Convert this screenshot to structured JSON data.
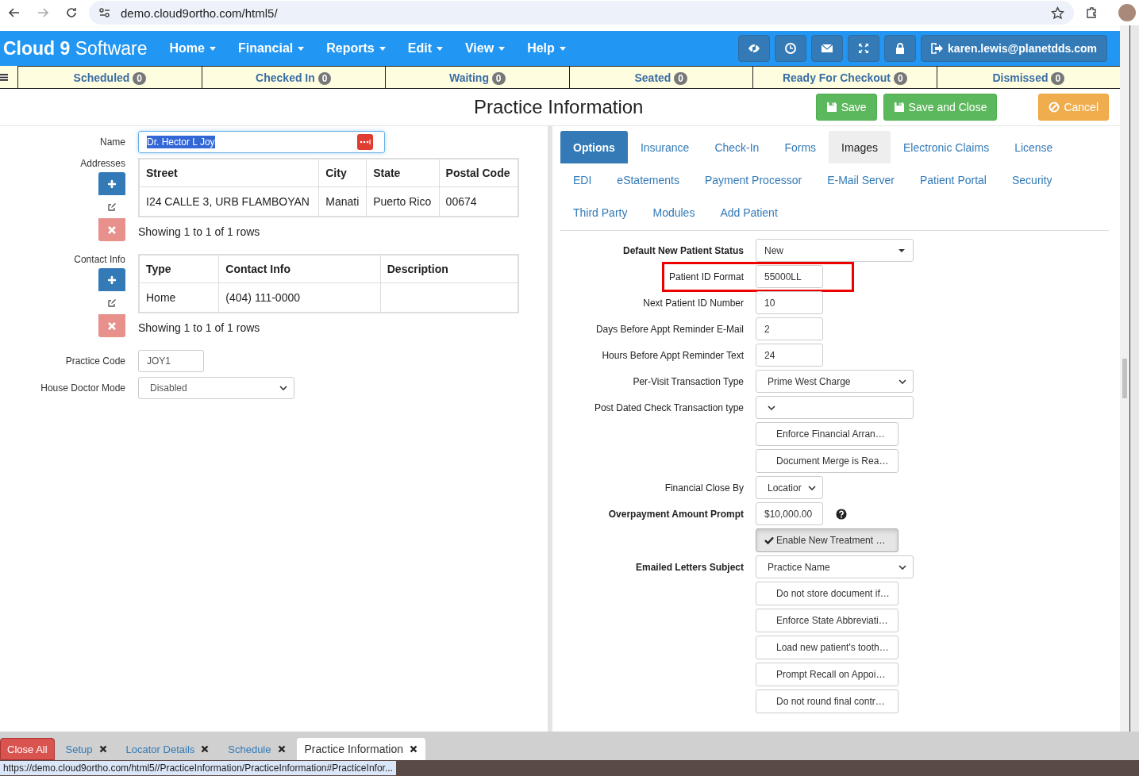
{
  "browser": {
    "url": "demo.cloud9ortho.com/html5/"
  },
  "navbar": {
    "brand_bold": "Cloud 9",
    "brand_light": "Software",
    "menus": [
      "Home",
      "Financial",
      "Reports",
      "Edit",
      "View",
      "Help"
    ],
    "user": "karen.lewis@planetdds.com"
  },
  "status_tabs": [
    {
      "label": "Scheduled",
      "count": "0"
    },
    {
      "label": "Checked In",
      "count": "0"
    },
    {
      "label": "Waiting",
      "count": "0"
    },
    {
      "label": "Seated",
      "count": "0"
    },
    {
      "label": "Ready For Checkout",
      "count": "0"
    },
    {
      "label": "Dismissed",
      "count": "0"
    }
  ],
  "page": {
    "title": "Practice Information",
    "buttons": [
      {
        "label": "Save",
        "kind": "save"
      },
      {
        "label": "Save and Close",
        "kind": "save"
      },
      {
        "label": "Cancel",
        "kind": "cancel"
      }
    ]
  },
  "practice": {
    "name_label": "Name",
    "name": "Dr. Hector L Joy",
    "name_selected": true,
    "addresses_label": "Addresses",
    "addresses": {
      "columns": [
        "Street",
        "City",
        "State",
        "Postal Code"
      ],
      "rows": [
        [
          "I24 CALLE 3, URB FLAMBOYAN",
          "Manati",
          "Puerto Rico",
          "00674"
        ]
      ],
      "footer": "Showing 1 to 1 of 1 rows"
    },
    "contact_label": "Contact Info",
    "contacts": {
      "columns": [
        "Type",
        "Contact Info",
        "Description"
      ],
      "rows": [
        [
          "Home",
          "(404) 111-0000",
          ""
        ]
      ],
      "footer": "Showing 1 to 1 of 1 rows"
    },
    "code_label": "Practice Code",
    "code": "JOY1",
    "doctor_mode_label": "House Doctor Mode",
    "doctor_mode": "Disabled"
  },
  "settings_tabs": [
    [
      {
        "label": "Options",
        "selected": true,
        "hovered": false
      },
      {
        "label": "Insurance",
        "selected": false,
        "hovered": false
      },
      {
        "label": "Check-In",
        "selected": false,
        "hovered": false
      },
      {
        "label": "Forms",
        "selected": false,
        "hovered": false
      },
      {
        "label": "Images",
        "selected": false,
        "hovered": true
      },
      {
        "label": "Electronic Claims",
        "selected": false,
        "hovered": false
      },
      {
        "label": "License",
        "selected": false,
        "hovered": false
      }
    ],
    [
      {
        "label": "EDI",
        "selected": false,
        "hovered": false
      },
      {
        "label": "eStatements",
        "selected": false,
        "hovered": false
      },
      {
        "label": "Payment Processor",
        "selected": false,
        "hovered": false
      },
      {
        "label": "E-Mail Server",
        "selected": false,
        "hovered": false
      },
      {
        "label": "Patient Portal",
        "selected": false,
        "hovered": false
      },
      {
        "label": "Security",
        "selected": false,
        "hovered": false
      }
    ],
    [
      {
        "label": "Third Party",
        "selected": false,
        "hovered": false
      },
      {
        "label": "Modules",
        "selected": false,
        "hovered": false
      },
      {
        "label": "Add Patient",
        "selected": false,
        "hovered": false
      }
    ]
  ],
  "settings": [
    {
      "kind": "dropdown",
      "label": "Default New Patient Status",
      "bold": true,
      "value": "New"
    },
    {
      "kind": "input",
      "label": "Patient ID Format",
      "bold": false,
      "value": "55000LL",
      "highlighted": true
    },
    {
      "kind": "input",
      "label": "Next Patient ID Number",
      "bold": false,
      "value": "10"
    },
    {
      "kind": "input",
      "label": "Days Before Appt Reminder E-Mail",
      "bold": false,
      "value": "2"
    },
    {
      "kind": "input",
      "label": "Hours Before Appt Reminder Text",
      "bold": false,
      "value": "24"
    },
    {
      "kind": "select",
      "label": "Per-Visit Transaction Type",
      "bold": false,
      "value": "Prime West Charge"
    },
    {
      "kind": "select",
      "label": "Post Dated Check Transaction type",
      "bold": false
    },
    {
      "kind": "toggle",
      "label_text": "Enforce Financial Arran…",
      "checked": false
    },
    {
      "kind": "toggle",
      "label_text": "Document Merge is Rea…",
      "checked": false
    },
    {
      "kind": "small-select",
      "label": "Financial Close By",
      "bold": false,
      "value": "Locatior"
    },
    {
      "kind": "input",
      "label": "Overpayment Amount Prompt",
      "bold": true,
      "value": "$10,000.00",
      "help": true
    },
    {
      "kind": "toggle",
      "label_text": "Enable New Treatment …",
      "checked": true
    },
    {
      "kind": "select",
      "label": "Emailed Letters Subject",
      "bold": true,
      "value": "Practice Name"
    },
    {
      "kind": "toggle",
      "label_text": "Do not store document if…",
      "checked": false
    },
    {
      "kind": "toggle",
      "label_text": "Enforce State Abbreviati…",
      "checked": false
    },
    {
      "kind": "toggle",
      "label_text": "Load new patient's tooth…",
      "checked": false
    },
    {
      "kind": "toggle",
      "label_text": "Prompt Recall on Appoi…",
      "checked": false
    },
    {
      "kind": "toggle",
      "label_text": "Do not round final contr…",
      "checked": false
    }
  ],
  "bottom_tabs": [
    {
      "label": "Close All",
      "kind": "close-all"
    },
    {
      "label": "Setup",
      "kind": "tab",
      "selected": false
    },
    {
      "label": "Locator Details",
      "kind": "tab",
      "selected": false
    },
    {
      "label": "Schedule",
      "kind": "tab",
      "selected": false
    },
    {
      "label": "Practice Information",
      "kind": "tab",
      "selected": true
    }
  ],
  "status_url": "https://demo.cloud9ortho.com/html5//PracticeInformation/PracticeInformation#PracticeInfor..."
}
